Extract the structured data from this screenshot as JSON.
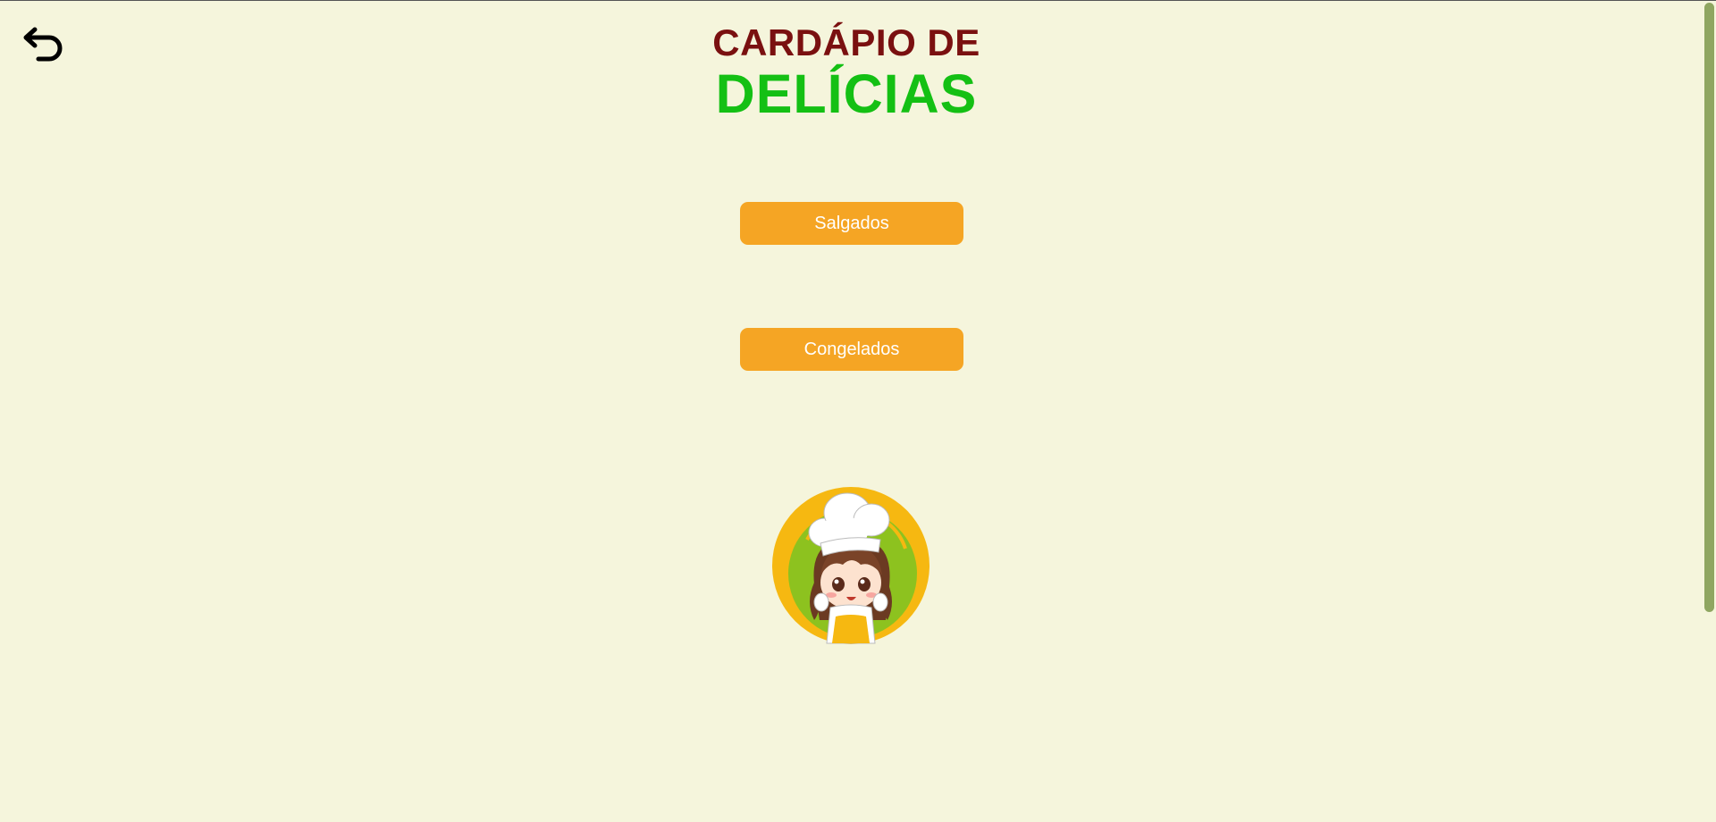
{
  "header": {
    "title_top": "CARDÁPIO DE",
    "title_main": "DELÍCIAS"
  },
  "navigation": {
    "back_icon": "undo-arrow-icon"
  },
  "menu": {
    "buttons": [
      {
        "label": "Salgados"
      },
      {
        "label": "Congelados"
      }
    ]
  },
  "logo": {
    "icon": "chef-girl-mascot"
  },
  "colors": {
    "background": "#f5f5dc",
    "title_top": "#7a1010",
    "title_main": "#14c014",
    "button": "#f5a524",
    "button_text": "#ffffff",
    "scrollbar": "#8fa661"
  }
}
